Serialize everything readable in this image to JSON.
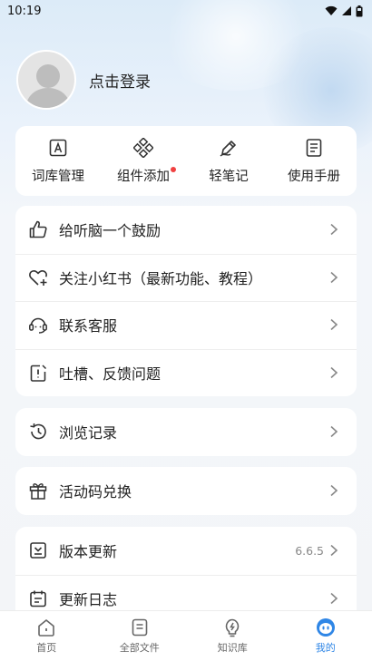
{
  "status_bar": {
    "time": "10:19"
  },
  "profile": {
    "login_text": "点击登录"
  },
  "tools": [
    {
      "label": "词库管理",
      "icon": "dictionary-icon"
    },
    {
      "label": "组件添加",
      "icon": "widget-icon",
      "has_badge": true
    },
    {
      "label": "轻笔记",
      "icon": "pen-icon"
    },
    {
      "label": "使用手册",
      "icon": "manual-icon"
    }
  ],
  "menu_group1": [
    {
      "label": "给听脑一个鼓励",
      "icon": "thumbs-up-icon"
    },
    {
      "label": "关注小红书（最新功能、教程）",
      "icon": "heart-plus-icon"
    },
    {
      "label": "联系客服",
      "icon": "headset-icon"
    },
    {
      "label": "吐槽、反馈问题",
      "icon": "feedback-icon"
    }
  ],
  "menu_group2": [
    {
      "label": "浏览记录",
      "icon": "history-icon"
    }
  ],
  "menu_group3": [
    {
      "label": "活动码兑换",
      "icon": "gift-icon"
    }
  ],
  "menu_group4": [
    {
      "label": "版本更新",
      "icon": "download-box-icon",
      "value": "6.6.5"
    },
    {
      "label": "更新日志",
      "icon": "calendar-icon"
    }
  ],
  "tabs": [
    {
      "label": "首页",
      "icon": "home-icon",
      "active": false
    },
    {
      "label": "全部文件",
      "icon": "files-icon",
      "active": false
    },
    {
      "label": "知识库",
      "icon": "knowledge-bulb-icon",
      "active": false
    },
    {
      "label": "我的",
      "icon": "mine-face-icon",
      "active": true
    }
  ],
  "colors": {
    "accent": "#2f86e6",
    "badge_red": "#f04141"
  }
}
